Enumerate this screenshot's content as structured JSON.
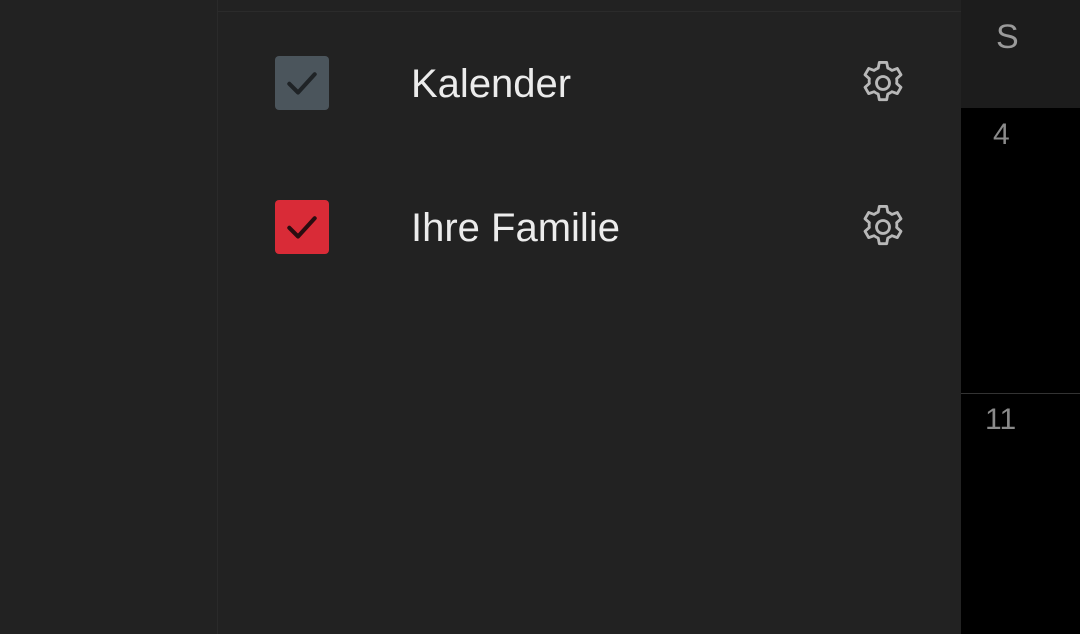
{
  "drawer": {
    "calendars": [
      {
        "label": "Kalender",
        "checked": true,
        "color": "#4b555c",
        "icon": "check-icon",
        "settings_icon": "gear-icon"
      },
      {
        "label": "Ihre Familie",
        "checked": true,
        "color": "#d92b37",
        "icon": "check-icon",
        "settings_icon": "gear-icon"
      }
    ]
  },
  "calendar": {
    "day_header": "S",
    "dates": [
      "4",
      "11"
    ]
  },
  "colors": {
    "drawer_bg": "#222222",
    "text": "#ececec",
    "gear": "#b8b8b8",
    "background": "#000000"
  }
}
